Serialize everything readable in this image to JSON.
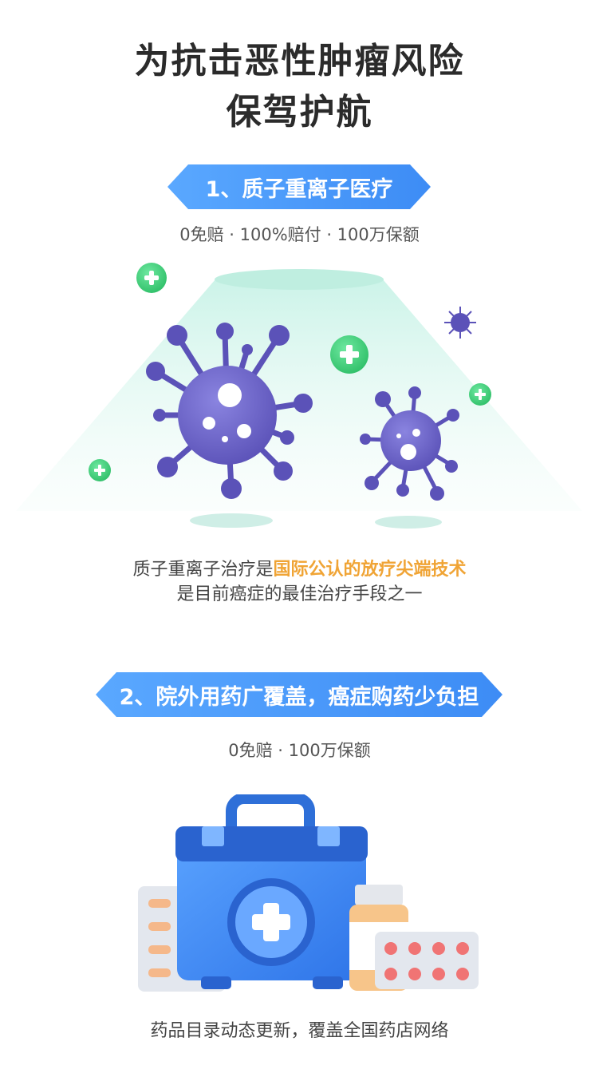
{
  "header": {
    "title_line1": "为抗击恶性肿瘤风险",
    "title_line2": "保驾护航"
  },
  "section1": {
    "banner": "1、质子重离子医疗",
    "subline": "0免赔 · 100%赔付 · 100万保额",
    "desc_part1": "质子重离子治疗是",
    "desc_highlight": "国际公认的放疗尖端技术",
    "desc_line2": "是目前癌症的最佳治疗手段之一"
  },
  "section2": {
    "banner": "2、院外用药广覆盖，癌症购药少负担",
    "subline": "0免赔 · 100万保额",
    "desc": "药品目录动态更新，覆盖全国药店网络"
  },
  "colors": {
    "banner_blue": "#3d8cf5",
    "highlight_orange": "#f0a435",
    "virus_purple": "#6a62c8",
    "plus_green": "#3fd07a"
  }
}
